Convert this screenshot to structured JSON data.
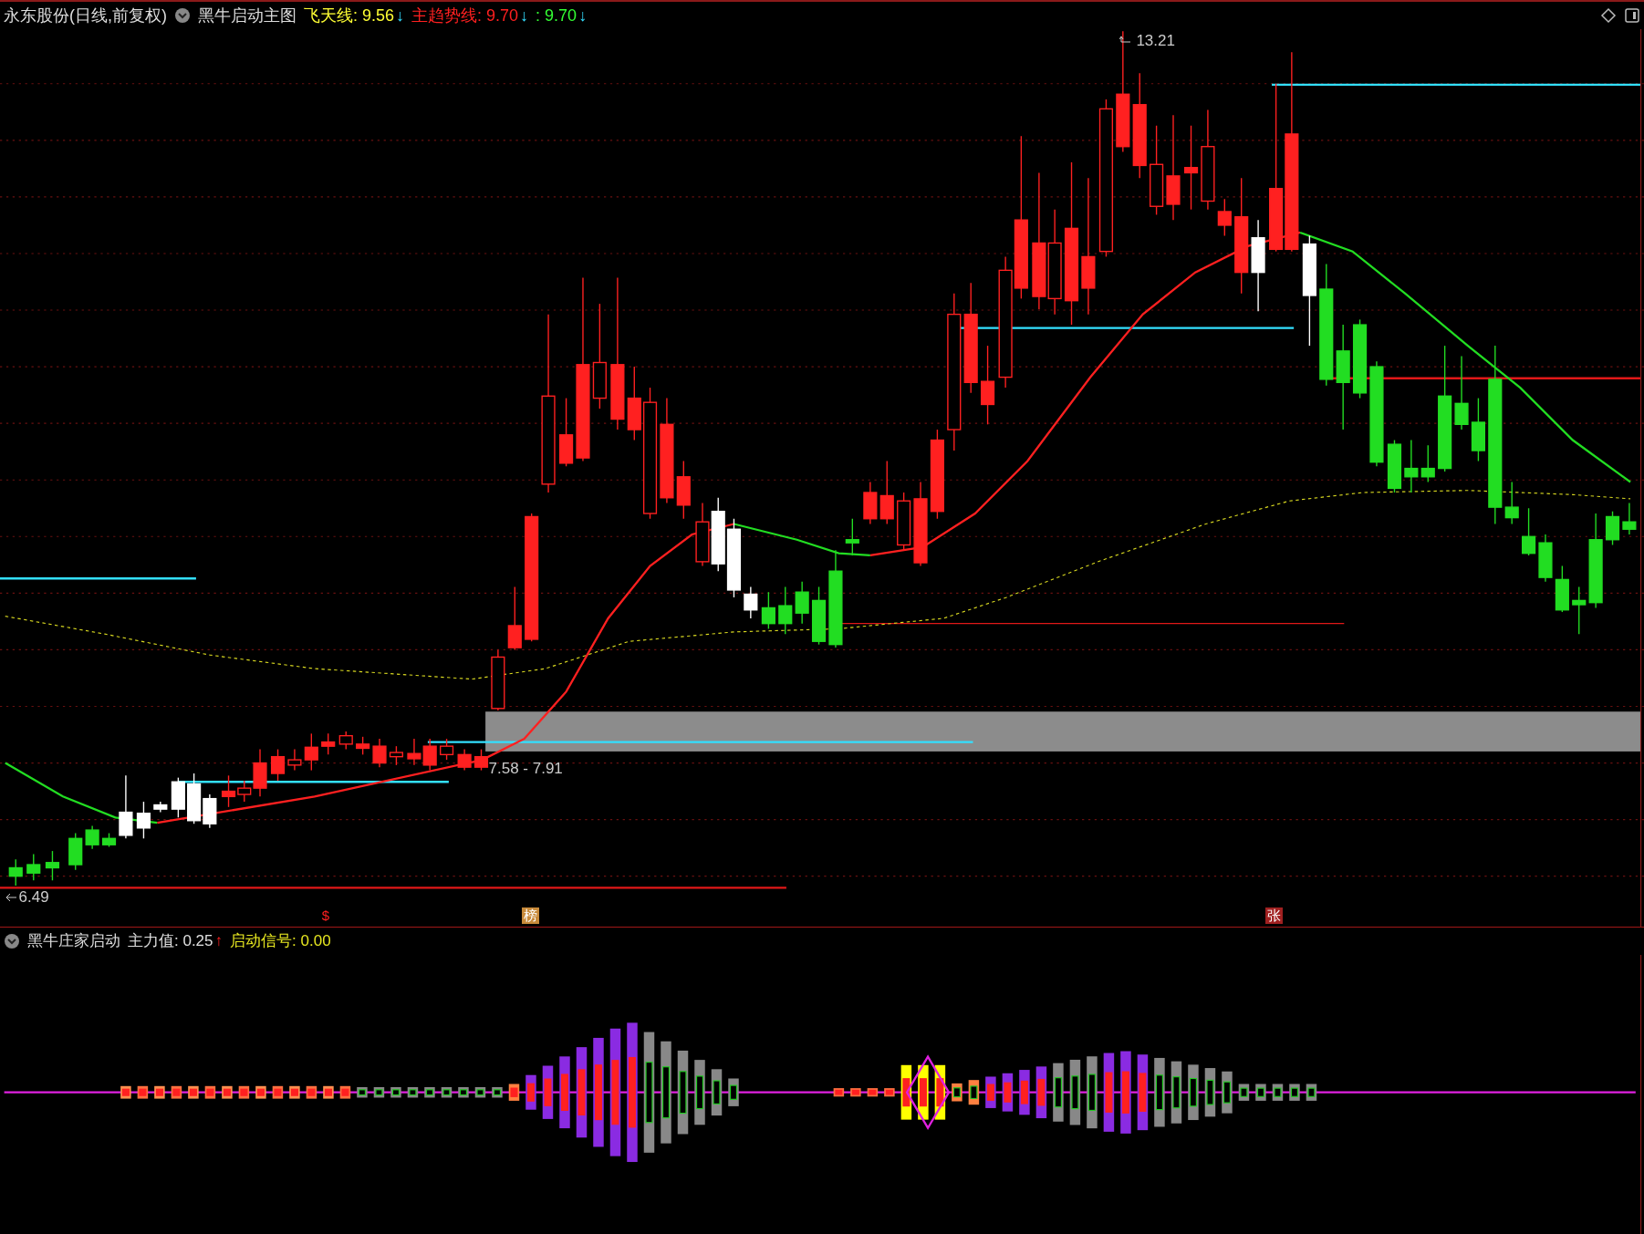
{
  "header": {
    "stock": "永东股份(日线,前复权)",
    "chart_name": "黑牛启动主图",
    "lines": [
      {
        "text": "飞天线: 9.56",
        "color": "#ffff33",
        "arrow": "↓"
      },
      {
        "text": "主趋势线: 9.70",
        "color": "#ff2020",
        "arrow": "↓"
      },
      {
        "text": ": 9.70",
        "color": "#33ff33",
        "arrow": "↓"
      }
    ]
  },
  "main_chart": {
    "price_labels": [
      "13.21",
      "7.58 - 7.91",
      "6.49"
    ],
    "markers": [
      {
        "text": "$",
        "kind": "plain"
      },
      {
        "text": "榜",
        "kind": "tag",
        "color": "#c88a3a"
      },
      {
        "text": "张",
        "kind": "tag",
        "color": "#a02020"
      }
    ]
  },
  "indicator": {
    "name": "黑牛庄家启动",
    "values": [
      {
        "text": "主力值: 0.25",
        "color": "#e0e0e0",
        "arrow": "↑"
      },
      {
        "text": "启动信号: 0.00",
        "color": "#e6e620"
      }
    ]
  }
}
